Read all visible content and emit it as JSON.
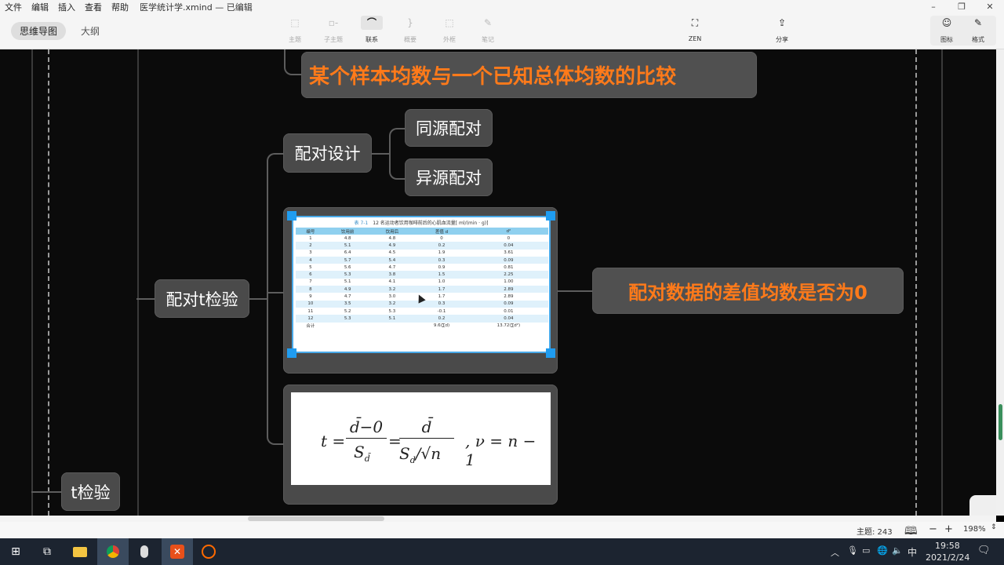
{
  "menu": {
    "items": [
      "文件",
      "编辑",
      "插入",
      "查看",
      "帮助"
    ],
    "doc_title": "医学统计学.xmind — 已编辑"
  },
  "view_tabs": [
    {
      "label": "思维导图",
      "active": true
    },
    {
      "label": "大纲",
      "active": false
    }
  ],
  "toolbar": [
    {
      "label": "主题",
      "icon": "topic-icon",
      "glyph": "⬚",
      "enabled": false
    },
    {
      "label": "子主题",
      "icon": "subtopic-icon",
      "glyph": "▫-",
      "enabled": false
    },
    {
      "label": "联系",
      "icon": "relationship-icon",
      "glyph": "⌒",
      "enabled": true
    },
    {
      "label": "概要",
      "icon": "summary-icon",
      "glyph": "}",
      "enabled": false
    },
    {
      "label": "外框",
      "icon": "boundary-icon",
      "glyph": "⬚",
      "enabled": false
    },
    {
      "label": "笔记",
      "icon": "note-icon",
      "glyph": "✎",
      "enabled": false
    }
  ],
  "zen": {
    "label": "ZEN",
    "glyph": "⛶"
  },
  "share": {
    "label": "分享",
    "glyph": "⇪"
  },
  "panel_tabs": [
    {
      "label": "图标",
      "glyph": "☺"
    },
    {
      "label": "格式",
      "glyph": "✎"
    }
  ],
  "mindmap": {
    "top_note": "某个样本均数与一个已知总体均数的比较",
    "paired_design": "配对设计",
    "same_source": "同源配对",
    "diff_source": "异源配对",
    "paired_t": "配对t检验",
    "paired_note": "配对数据的差值均数是否为0",
    "t_test": "t检验"
  },
  "table_image": {
    "caption_label": "表 7-1",
    "caption": "12 名运动者饮用咖啡前后的心肌血流量[ ml/(min · g)]",
    "headers": [
      "编号",
      "饮用前",
      "饮用后",
      "差值 d",
      "d²"
    ],
    "rows": [
      [
        "1",
        "4.8",
        "4.8",
        "0",
        "0"
      ],
      [
        "2",
        "5.1",
        "4.9",
        "0.2",
        "0.04"
      ],
      [
        "3",
        "6.4",
        "4.5",
        "1.9",
        "3.61"
      ],
      [
        "4",
        "5.7",
        "5.4",
        "0.3",
        "0.09"
      ],
      [
        "5",
        "5.6",
        "4.7",
        "0.9",
        "0.81"
      ],
      [
        "6",
        "5.3",
        "3.8",
        "1.5",
        "2.25"
      ],
      [
        "7",
        "5.1",
        "4.1",
        "1.0",
        "1.00"
      ],
      [
        "8",
        "4.9",
        "3.2",
        "1.7",
        "2.89"
      ],
      [
        "9",
        "4.7",
        "3.0",
        "1.7",
        "2.89"
      ],
      [
        "10",
        "3.5",
        "3.2",
        "0.3",
        "0.09"
      ],
      [
        "11",
        "5.2",
        "5.3",
        "-0.1",
        "0.01"
      ],
      [
        "12",
        "5.3",
        "5.1",
        "0.2",
        "0.04"
      ]
    ],
    "total": [
      "合计",
      "",
      "",
      "9.6(∑d)",
      "13.72(∑d²)"
    ]
  },
  "formula": {
    "t": "t =",
    "num1": "d̄−0",
    "den1": "S",
    "den1_sub": "d̄",
    "eq": "=",
    "num2": "d̄",
    "den2": "S",
    "den2_sub": "d",
    "den2_tail": "/√n",
    "dof": ", ν = n − 1"
  },
  "status": {
    "topic_count": "主题: 243",
    "zoom": "198%",
    "zoom_out": "−",
    "zoom_in": "+"
  },
  "taskbar": {
    "time": "19:58",
    "date": "2021/2/24",
    "ime": "中",
    "apps": [
      "windows-start",
      "task-view",
      "file-explorer",
      "chrome",
      "recorder",
      "xmind",
      "app-circle"
    ]
  },
  "colors": {
    "accent_orange": "#ff7a1a",
    "node_bg": "#4a4a4a",
    "selection_blue": "#1f9cf0"
  }
}
